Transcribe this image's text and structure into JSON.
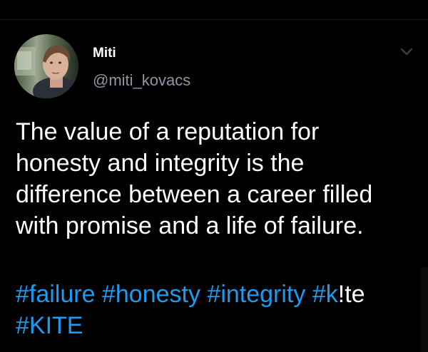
{
  "author": {
    "display_name": "Miti",
    "handle": "@miti_kovacs",
    "avatar_icon": "profile-photo"
  },
  "menu_icon": "chevron-down-icon",
  "tweet": {
    "lines": [
      "The value of a reputation for",
      "honesty and integrity is the",
      "difference between a career filled",
      "with promise and a life of failure."
    ],
    "hashtags_line1": [
      {
        "text": "#failure",
        "type": "hashtag"
      },
      {
        "text": "#honesty",
        "type": "hashtag"
      },
      {
        "text": "#integrity",
        "type": "hashtag"
      },
      {
        "text": "#k",
        "type": "hashtag"
      },
      {
        "text": "!te",
        "type": "plain"
      }
    ],
    "hashtags_line2": [
      {
        "text": "#KITE",
        "type": "hashtag"
      }
    ]
  },
  "colors": {
    "background": "#000000",
    "text": "#ffffff",
    "secondary_text": "#8b98a5",
    "link": "#1d9bf0"
  }
}
